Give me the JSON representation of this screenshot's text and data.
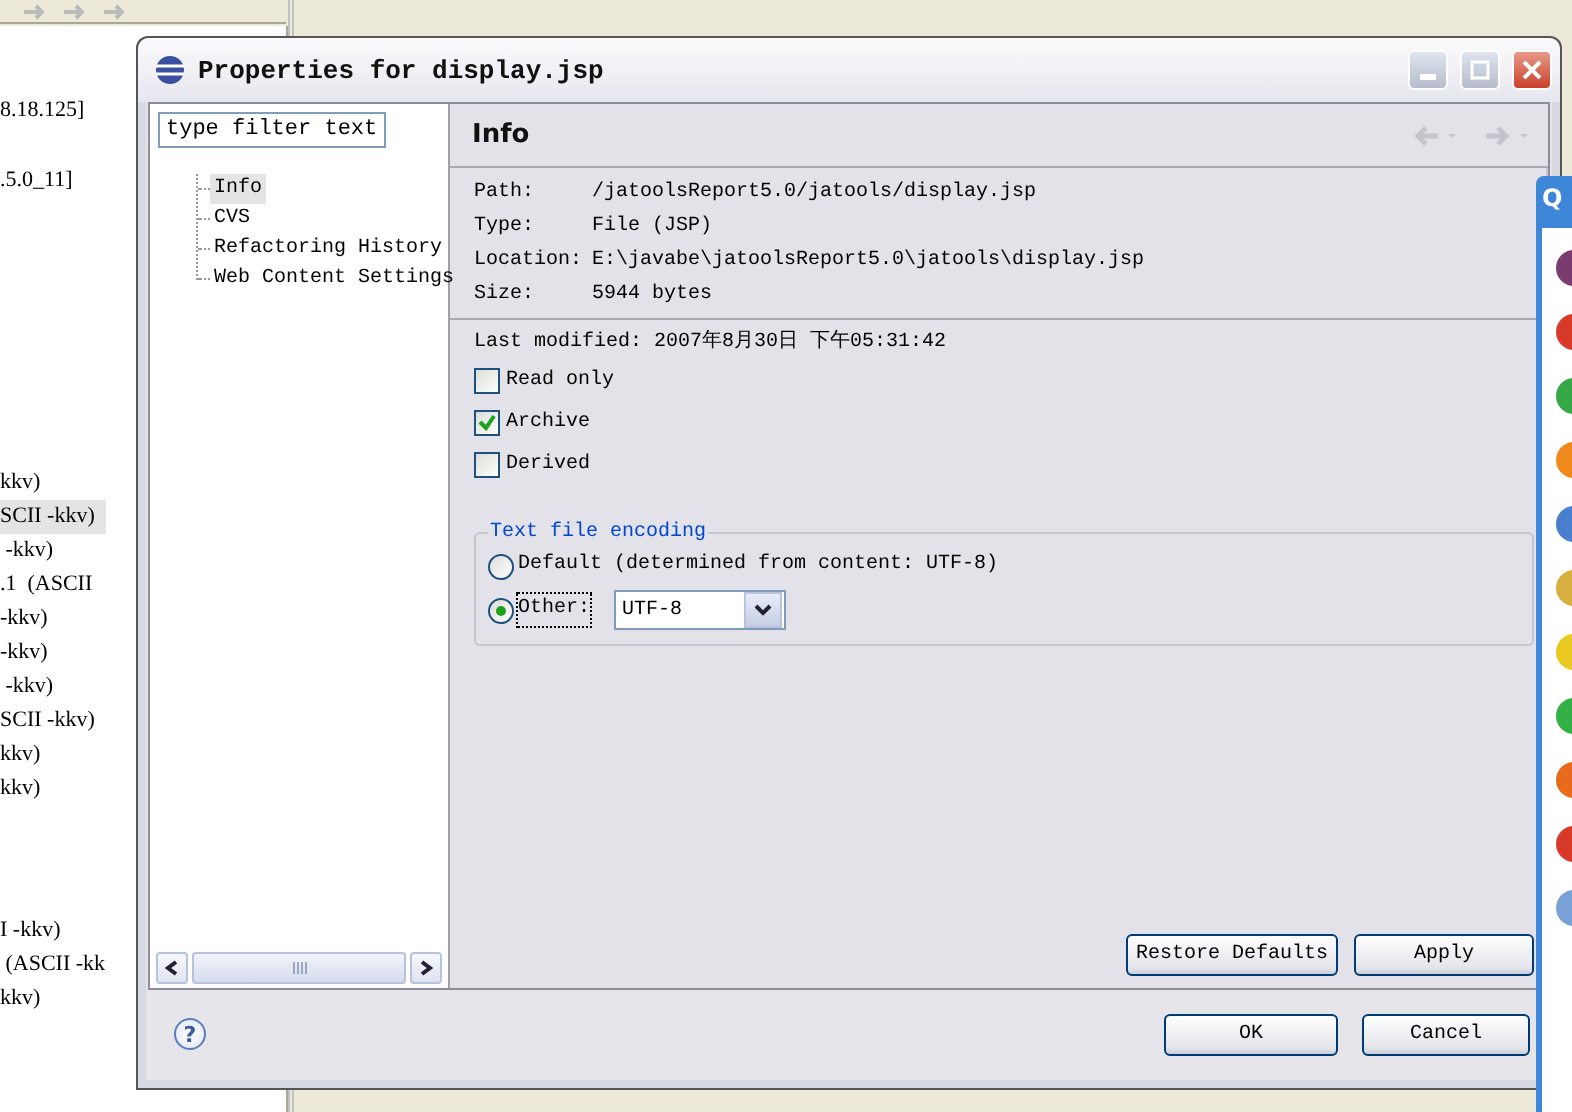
{
  "editor": {
    "blocks": [
      [
        {
          "text": "8.18.125]",
          "selected": false
        }
      ],
      [
        {
          "text": ".5.0_11]",
          "selected": false
        }
      ],
      [
        {
          "text": "kkv)",
          "selected": false
        },
        {
          "text": "SCII -kkv)",
          "selected": true
        },
        {
          "text": " -kkv)",
          "selected": false
        },
        {
          "text": ".1  (ASCII",
          "selected": false
        },
        {
          "text": "-kkv)",
          "selected": false
        },
        {
          "text": "-kkv)",
          "selected": false
        },
        {
          "text": " -kkv)",
          "selected": false
        },
        {
          "text": "SCII -kkv)",
          "selected": false
        },
        {
          "text": "kkv)",
          "selected": false
        },
        {
          "text": "kkv)",
          "selected": false
        }
      ],
      [
        {
          "text": "I -kkv)",
          "selected": false
        },
        {
          "text": " (ASCII -kk",
          "selected": false
        },
        {
          "text": "kkv)",
          "selected": false
        }
      ]
    ]
  },
  "dialog": {
    "title": "Properties for display.jsp",
    "filter": {
      "value": "type filter text"
    },
    "tree": [
      {
        "label": "Info",
        "selected": true
      },
      {
        "label": "CVS",
        "selected": false
      },
      {
        "label": "Refactoring History",
        "selected": false
      },
      {
        "label": "Web Content Settings",
        "selected": false
      }
    ],
    "page": {
      "title": "Info",
      "properties": [
        {
          "label": "Path:",
          "value": "/jatoolsReport5.0/jatools/display.jsp"
        },
        {
          "label": "Type:",
          "value": "File  (JSP)"
        },
        {
          "label": "Location:",
          "value": "E:\\javabe\\jatoolsReport5.0\\jatools\\display.jsp"
        },
        {
          "label": "Size:",
          "value": "5944  bytes"
        }
      ],
      "last_modified": "Last modified: 2007年8月30日 下午05:31:42",
      "attributes": [
        {
          "label": "Read only",
          "checked": false
        },
        {
          "label": "Archive",
          "checked": true
        },
        {
          "label": "Derived",
          "checked": false
        }
      ],
      "encoding": {
        "title": "Text file encoding",
        "options": [
          {
            "label": "Default (determined from content: UTF-8)",
            "selected": false
          },
          {
            "label": "Other:",
            "selected": true
          }
        ],
        "value": "UTF-8"
      },
      "buttons": [
        "Restore Defaults",
        "Apply"
      ]
    },
    "help": "?",
    "buttons": [
      "OK",
      "Cancel"
    ]
  },
  "side_panel": {
    "title": "Q"
  }
}
